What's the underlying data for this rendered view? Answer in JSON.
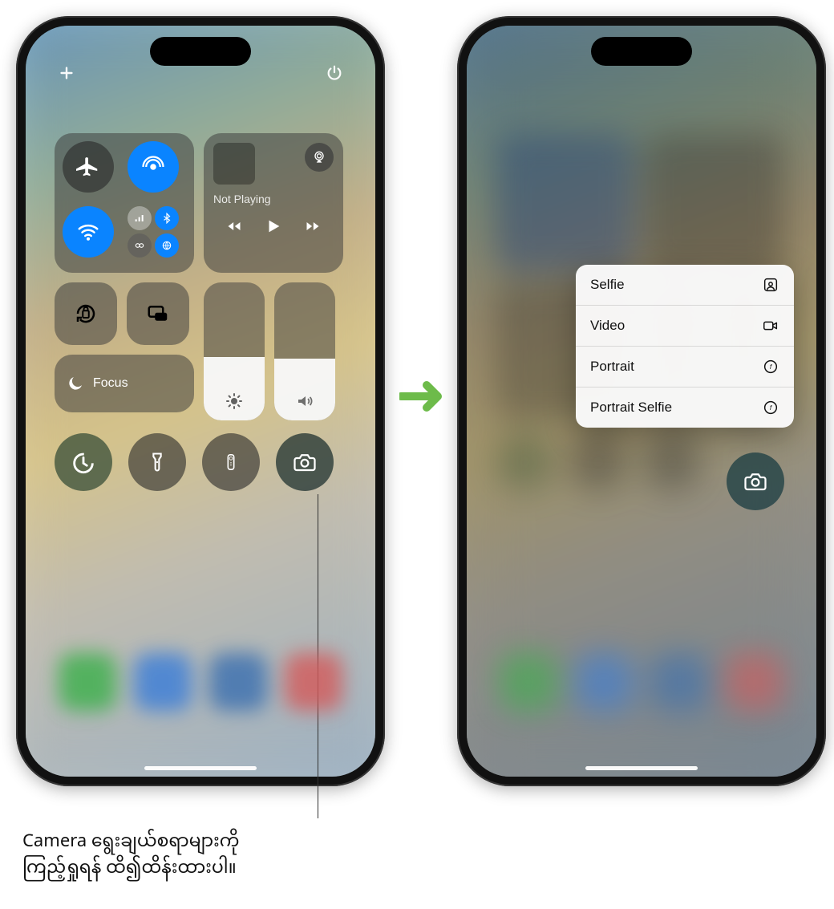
{
  "media": {
    "status": "Not Playing"
  },
  "focus": {
    "label": "Focus"
  },
  "camera_menu": {
    "items": [
      {
        "label": "Selfie"
      },
      {
        "label": "Video"
      },
      {
        "label": "Portrait"
      },
      {
        "label": "Portrait Selfie"
      }
    ]
  },
  "callout": {
    "line1": "Camera ရွေးချယ်စရာများကို",
    "line2": "ကြည့်ရှုရန် ထိ၍ထိန်းထားပါ။"
  }
}
